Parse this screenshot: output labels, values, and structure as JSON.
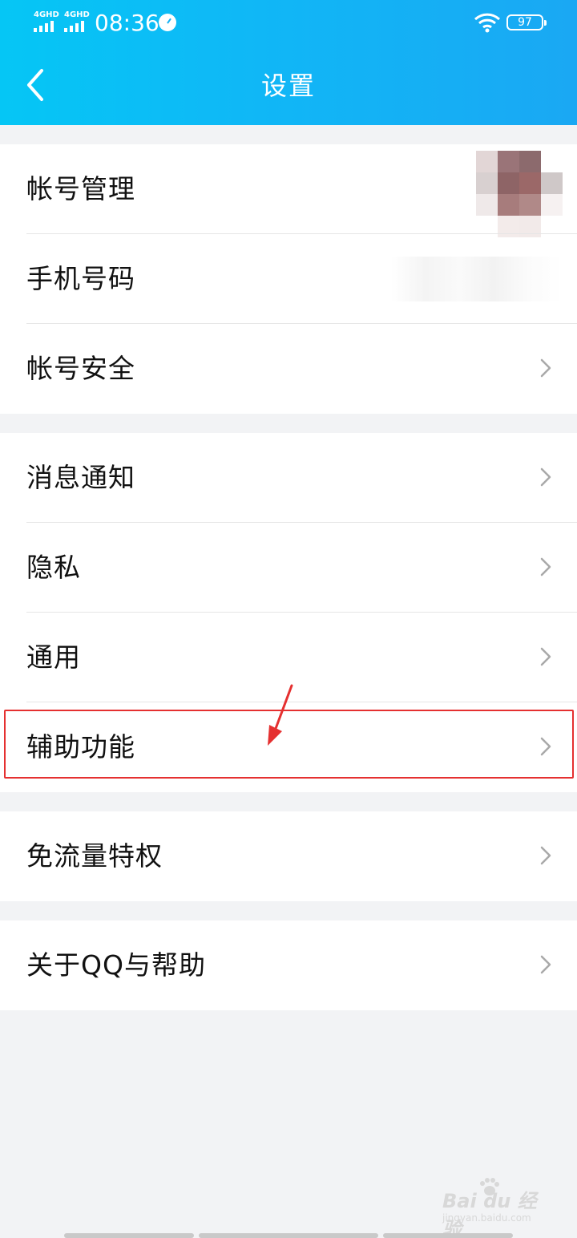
{
  "status_bar": {
    "network_1": "4GHD",
    "network_2": "4GHD",
    "time": "08:36",
    "battery": "97"
  },
  "header": {
    "title": "设置",
    "background_color": "#10b7f6"
  },
  "groups": [
    {
      "items": [
        {
          "label": "帐号管理",
          "trailing": "avatar"
        },
        {
          "label": "手机号码",
          "trailing": "masked-value"
        },
        {
          "label": "帐号安全",
          "trailing": "chevron"
        }
      ]
    },
    {
      "items": [
        {
          "label": "消息通知",
          "trailing": "chevron"
        },
        {
          "label": "隐私",
          "trailing": "chevron"
        },
        {
          "label": "通用",
          "trailing": "chevron"
        },
        {
          "label": "辅助功能",
          "trailing": "chevron",
          "highlighted": true
        }
      ]
    },
    {
      "items": [
        {
          "label": "免流量特权",
          "trailing": "chevron"
        }
      ]
    },
    {
      "items": [
        {
          "label": "关于QQ与帮助",
          "trailing": "chevron"
        }
      ]
    }
  ],
  "annotation": {
    "highlight_color": "#e53030"
  },
  "watermark": {
    "brand": "Bai du 经验",
    "url": "jingyan.baidu.com"
  }
}
